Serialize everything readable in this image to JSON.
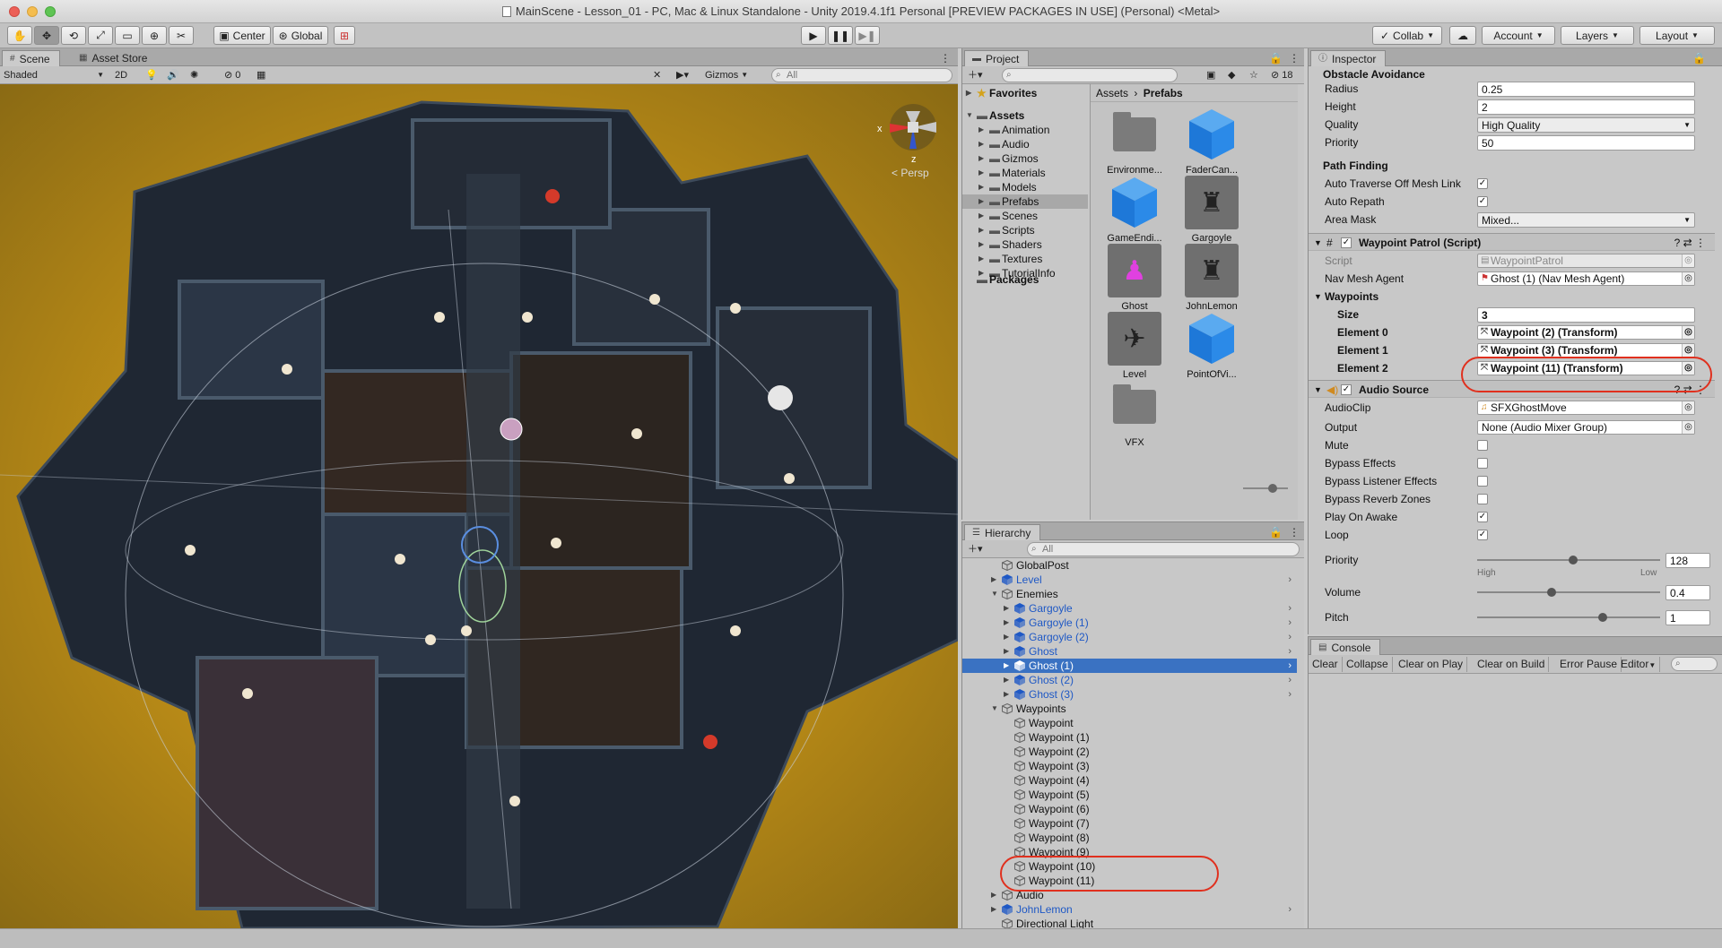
{
  "window": {
    "title": "MainScene - Lesson_01 - PC, Mac & Linux Standalone - Unity 2019.4.1f1 Personal [PREVIEW PACKAGES IN USE] (Personal) <Metal>"
  },
  "toolbar": {
    "pivot_label": "Center",
    "space_label": "Global",
    "collab_label": "Collab",
    "account_label": "Account",
    "layers_label": "Layers",
    "layout_label": "Layout"
  },
  "scene_panel": {
    "tabs": [
      "Scene",
      "Asset Store"
    ],
    "shading_mode": "Shaded",
    "mode_2d": "2D",
    "hidden_count": "0",
    "gizmos_label": "Gizmos",
    "search_placeholder": "All",
    "persp_label": "< Persp",
    "axis_x": "x",
    "axis_z": "z"
  },
  "project_panel": {
    "tab": "Project",
    "hidden_count": "18",
    "favorites_label": "Favorites",
    "assets_label": "Assets",
    "folders": [
      "Animation",
      "Audio",
      "Gizmos",
      "Materials",
      "Models",
      "Prefabs",
      "Scenes",
      "Scripts",
      "Shaders",
      "Textures",
      "TutorialInfo"
    ],
    "selected_folder": "Prefabs",
    "packages_label": "Packages",
    "breadcrumb": [
      "Assets",
      "Prefabs"
    ],
    "items": [
      {
        "name": "Environme...",
        "kind": "folder"
      },
      {
        "name": "FaderCan...",
        "kind": "prefab"
      },
      {
        "name": "GameEndi...",
        "kind": "prefab"
      },
      {
        "name": "Gargoyle",
        "kind": "model"
      },
      {
        "name": "Ghost",
        "kind": "model"
      },
      {
        "name": "JohnLemon",
        "kind": "model"
      },
      {
        "name": "Level",
        "kind": "model"
      },
      {
        "name": "PointOfVi...",
        "kind": "prefab"
      },
      {
        "name": "VFX",
        "kind": "folder"
      }
    ]
  },
  "hierarchy_panel": {
    "tab": "Hierarchy",
    "search_placeholder": "All",
    "rows": [
      {
        "label": "GlobalPost",
        "indent": 0,
        "prefab": false,
        "arrow": "",
        "chev": false,
        "selected": false
      },
      {
        "label": "Level",
        "indent": 0,
        "prefab": true,
        "arrow": "▶",
        "chev": true,
        "selected": false
      },
      {
        "label": "Enemies",
        "indent": 0,
        "prefab": false,
        "arrow": "▼",
        "chev": false,
        "selected": false
      },
      {
        "label": "Gargoyle",
        "indent": 1,
        "prefab": true,
        "arrow": "▶",
        "chev": true,
        "selected": false
      },
      {
        "label": "Gargoyle (1)",
        "indent": 1,
        "prefab": true,
        "arrow": "▶",
        "chev": true,
        "selected": false
      },
      {
        "label": "Gargoyle (2)",
        "indent": 1,
        "prefab": true,
        "arrow": "▶",
        "chev": true,
        "selected": false
      },
      {
        "label": "Ghost",
        "indent": 1,
        "prefab": true,
        "arrow": "▶",
        "chev": true,
        "selected": false
      },
      {
        "label": "Ghost (1)",
        "indent": 1,
        "prefab": true,
        "arrow": "▶",
        "chev": true,
        "selected": true
      },
      {
        "label": "Ghost (2)",
        "indent": 1,
        "prefab": true,
        "arrow": "▶",
        "chev": true,
        "selected": false
      },
      {
        "label": "Ghost (3)",
        "indent": 1,
        "prefab": true,
        "arrow": "▶",
        "chev": true,
        "selected": false
      },
      {
        "label": "Waypoints",
        "indent": 0,
        "prefab": false,
        "arrow": "▼",
        "chev": false,
        "selected": false
      },
      {
        "label": "Waypoint",
        "indent": 1,
        "prefab": false,
        "arrow": "",
        "chev": false,
        "selected": false
      },
      {
        "label": "Waypoint (1)",
        "indent": 1,
        "prefab": false,
        "arrow": "",
        "chev": false,
        "selected": false
      },
      {
        "label": "Waypoint (2)",
        "indent": 1,
        "prefab": false,
        "arrow": "",
        "chev": false,
        "selected": false
      },
      {
        "label": "Waypoint (3)",
        "indent": 1,
        "prefab": false,
        "arrow": "",
        "chev": false,
        "selected": false
      },
      {
        "label": "Waypoint (4)",
        "indent": 1,
        "prefab": false,
        "arrow": "",
        "chev": false,
        "selected": false
      },
      {
        "label": "Waypoint (5)",
        "indent": 1,
        "prefab": false,
        "arrow": "",
        "chev": false,
        "selected": false
      },
      {
        "label": "Waypoint (6)",
        "indent": 1,
        "prefab": false,
        "arrow": "",
        "chev": false,
        "selected": false
      },
      {
        "label": "Waypoint (7)",
        "indent": 1,
        "prefab": false,
        "arrow": "",
        "chev": false,
        "selected": false
      },
      {
        "label": "Waypoint (8)",
        "indent": 1,
        "prefab": false,
        "arrow": "",
        "chev": false,
        "selected": false
      },
      {
        "label": "Waypoint (9)",
        "indent": 1,
        "prefab": false,
        "arrow": "",
        "chev": false,
        "selected": false
      },
      {
        "label": "Waypoint (10)",
        "indent": 1,
        "prefab": false,
        "arrow": "",
        "chev": false,
        "selected": false
      },
      {
        "label": "Waypoint (11)",
        "indent": 1,
        "prefab": false,
        "arrow": "",
        "chev": false,
        "selected": false
      },
      {
        "label": "Audio",
        "indent": 0,
        "prefab": false,
        "arrow": "▶",
        "chev": false,
        "selected": false
      },
      {
        "label": "JohnLemon",
        "indent": 0,
        "prefab": true,
        "arrow": "▶",
        "chev": true,
        "selected": false
      },
      {
        "label": "Directional Light",
        "indent": 0,
        "prefab": false,
        "arrow": "",
        "chev": false,
        "selected": false
      }
    ]
  },
  "inspector": {
    "tab": "Inspector",
    "obstacle_header": "Obstacle Avoidance",
    "radius_label": "Radius",
    "radius": "0.25",
    "height_label": "Height",
    "height": "2",
    "quality_label": "Quality",
    "quality": "High Quality",
    "priority_label": "Priority",
    "priority": "50",
    "pathfinding_header": "Path Finding",
    "auto_traverse_label": "Auto Traverse Off Mesh Link",
    "auto_traverse": "✓",
    "auto_repath_label": "Auto Repath",
    "auto_repath": "✓",
    "area_mask_label": "Area Mask",
    "area_mask": "Mixed...",
    "waypoint_patrol": {
      "title": "Waypoint Patrol (Script)",
      "script_label": "Script",
      "script": "WaypointPatrol",
      "nav_label": "Nav Mesh Agent",
      "nav": "Ghost (1) (Nav Mesh Agent)",
      "waypoints_label": "Waypoints",
      "size_label": "Size",
      "size": "3",
      "e0_label": "Element 0",
      "e0": "Waypoint (2) (Transform)",
      "e1_label": "Element 1",
      "e1": "Waypoint (3) (Transform)",
      "e2_label": "Element 2",
      "e2": "Waypoint (11) (Transform)"
    },
    "audio_source": {
      "title": "Audio Source",
      "clip_label": "AudioClip",
      "clip": "SFXGhostMove",
      "output_label": "Output",
      "output": "None (Audio Mixer Group)",
      "mute_label": "Mute",
      "bypass_label": "Bypass Effects",
      "bypass_listener_label": "Bypass Listener Effects",
      "bypass_reverb_label": "Bypass Reverb Zones",
      "play_on_awake_label": "Play On Awake",
      "play_on_awake": "✓",
      "loop_label": "Loop",
      "loop": "✓",
      "priority_label": "Priority",
      "priority": "128",
      "priority_fraction": 0.5,
      "high_label": "High",
      "low_label": "Low",
      "volume_label": "Volume",
      "volume": "0.4",
      "pitch_label": "Pitch",
      "pitch": "1"
    }
  },
  "console": {
    "tab": "Console",
    "buttons": [
      "Clear",
      "Collapse",
      "Clear on Play",
      "Clear on Build",
      "Error Pause",
      "Editor"
    ]
  },
  "colors": {
    "selection": "#3a72c2",
    "prefab_blue": "#1e58c5",
    "annotation_red": "#e0301e"
  }
}
